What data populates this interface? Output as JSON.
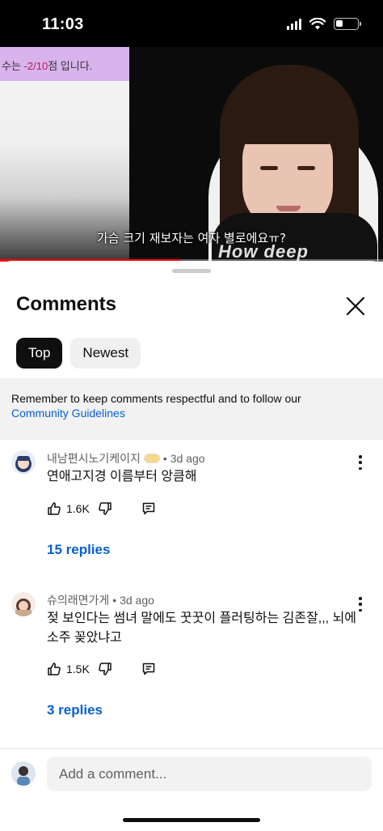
{
  "status_bar": {
    "time": "11:03",
    "battery_level": 0.3
  },
  "video": {
    "overlay_banner": {
      "prefix": "수는 ",
      "score": "-2/10",
      "suffix": "점 입니다."
    },
    "caption": "가슴 크기 재보자는 여자 별로에요ㅠ?",
    "shirt_logo": "How deep",
    "progress": 0.47
  },
  "sheet": {
    "title": "Comments",
    "chips": [
      {
        "label": "Top",
        "active": true
      },
      {
        "label": "Newest",
        "active": false
      }
    ],
    "notice": {
      "text": "Remember to keep comments respectful and to follow our",
      "link": "Community Guidelines"
    },
    "comments": [
      {
        "author": "내남편시노기케이지",
        "time": "• 3d ago",
        "text": "연애고지경 이름부터 앙큼해",
        "likes": "1.6K",
        "replies": "15 replies"
      },
      {
        "author": "슈의래면가게",
        "time": "• 3d ago",
        "text": "젖 보인다는 썸녀 말에도 꿋꿋이 플러팅하는 김존잘,,, 뇌에 소주 꽂았냐고",
        "likes": "1.5K",
        "replies": "3 replies"
      }
    ],
    "add_comment_placeholder": "Add a comment...",
    "colors": {
      "link": "#065fd4",
      "progress": "#ff0000",
      "banner": "#d8b3ec"
    }
  }
}
